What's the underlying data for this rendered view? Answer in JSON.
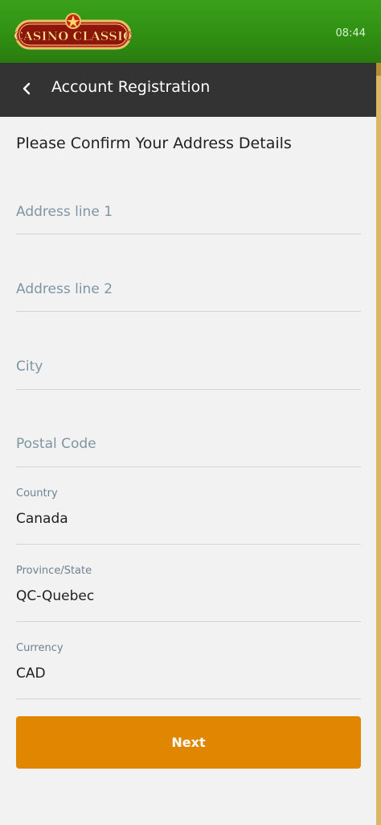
{
  "brand": {
    "logo_text": "CASINO CLASSIC"
  },
  "status": {
    "time": "08:44"
  },
  "appbar": {
    "title": "Account Registration"
  },
  "form": {
    "heading": "Please Confirm Your Address Details",
    "address1": {
      "placeholder": "Address line 1"
    },
    "address2": {
      "placeholder": "Address line 2"
    },
    "city": {
      "placeholder": "City"
    },
    "postal": {
      "placeholder": "Postal Code"
    },
    "country": {
      "label": "Country",
      "value": "Canada"
    },
    "province": {
      "label": "Province/State",
      "value": "QC-Quebec"
    },
    "currency": {
      "label": "Currency",
      "value": "CAD"
    }
  },
  "actions": {
    "next_label": "Next"
  },
  "colors": {
    "header_green": "#3aa11a",
    "appbar_dark": "#333333",
    "button_orange": "#e08600",
    "scroll_gold": "#d9b766"
  },
  "icons": {
    "back": "chevron-left-icon"
  }
}
